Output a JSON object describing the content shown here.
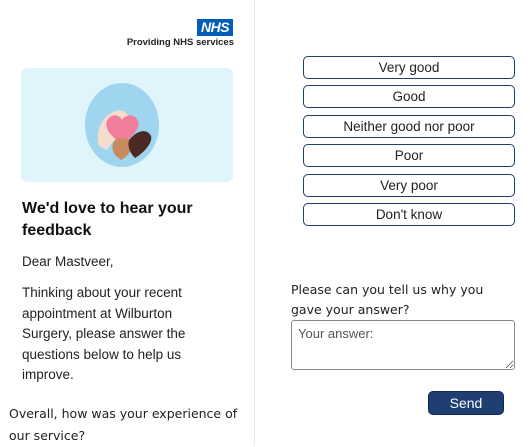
{
  "brand": {
    "logo_text": "NHS",
    "tagline": "Providing NHS services"
  },
  "content": {
    "heading": "We'd love to hear your feedback",
    "greeting": "Dear Mastveer,",
    "intro": "Thinking about your recent appointment at Wilburton Surgery, please answer the questions below to help us improve.",
    "question_experience": "Overall, how was your experience of our service?"
  },
  "rating_options": [
    {
      "label": "Very good"
    },
    {
      "label": "Good"
    },
    {
      "label": "Neither good nor poor"
    },
    {
      "label": "Poor"
    },
    {
      "label": "Very poor"
    },
    {
      "label": "Don't know"
    }
  ],
  "followup": {
    "question": "Please can you tell us why you gave your answer?",
    "placeholder": "Your answer:",
    "value": ""
  },
  "actions": {
    "send_label": "Send"
  },
  "colors": {
    "nhs_blue": "#005eb8",
    "button_border": "#1f3f73",
    "send_bg": "#1f3f73",
    "hero_bg": "#dff4fb"
  }
}
